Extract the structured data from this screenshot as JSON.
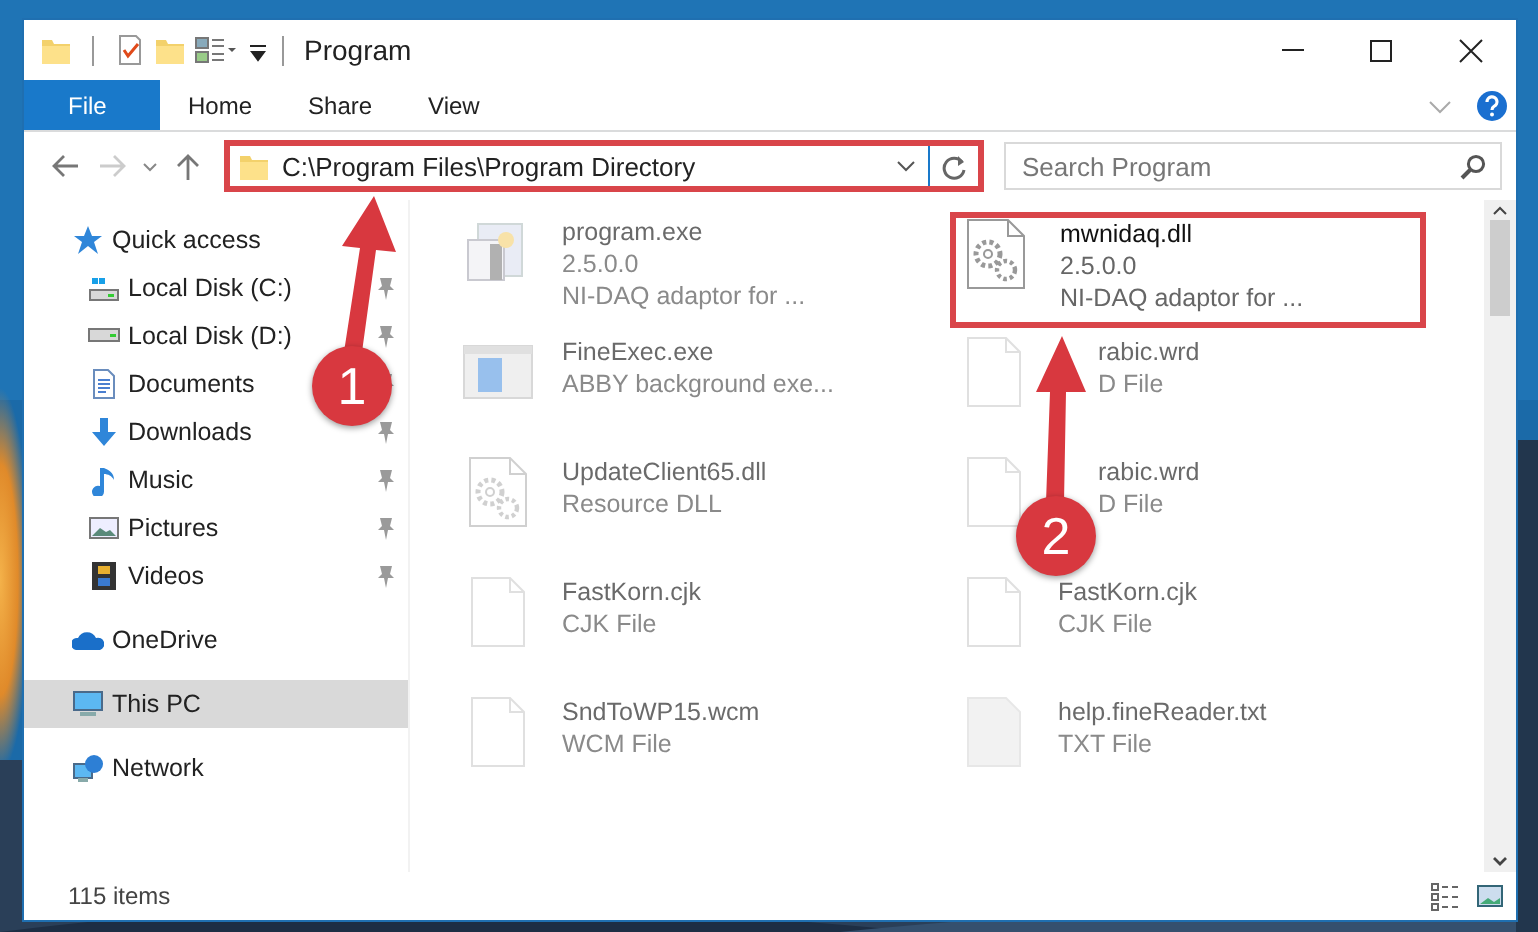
{
  "window": {
    "title": "Program"
  },
  "ribbon_tabs": [
    {
      "label": "File",
      "selected": true
    },
    {
      "label": "Home",
      "selected": false
    },
    {
      "label": "Share",
      "selected": false
    },
    {
      "label": "View",
      "selected": false
    }
  ],
  "address": {
    "path": "C:\\Program Files\\Program Directory",
    "highlighted": true
  },
  "search": {
    "placeholder": "Search Program"
  },
  "sidebar": {
    "items": [
      {
        "label": "Quick access",
        "selected": false,
        "children": [
          {
            "label": "Local Disk (C:)",
            "pinned": true,
            "selected": false
          },
          {
            "label": "Local Disk (D:)",
            "pinned": true,
            "selected": false
          },
          {
            "label": "Documents",
            "pinned": true,
            "selected": false
          },
          {
            "label": "Downloads",
            "pinned": true,
            "selected": false
          },
          {
            "label": "Music",
            "pinned": true,
            "selected": false
          },
          {
            "label": "Pictures",
            "pinned": true,
            "selected": false
          },
          {
            "label": "Videos",
            "pinned": true,
            "selected": false
          }
        ]
      },
      {
        "label": "OneDrive",
        "selected": false
      },
      {
        "label": "This PC",
        "selected": true
      },
      {
        "label": "Network",
        "selected": false
      }
    ]
  },
  "files": [
    {
      "kind": "app",
      "lines": [
        "program.exe",
        "2.5.0.0",
        "NI-DAQ adaptor for ..."
      ],
      "faded": true,
      "highlighted": false
    },
    {
      "kind": "settings-doc",
      "lines": [
        "mwnidaq.dll",
        "2.5.0.0",
        "NI-DAQ adaptor for ..."
      ],
      "faded": false,
      "highlighted": true
    },
    {
      "kind": "window",
      "lines": [
        "FineExec.exe",
        "ABBY background exe..."
      ],
      "faded": true,
      "highlighted": false
    },
    {
      "kind": "doc",
      "lines": [
        "rabic.wrd",
        "D File"
      ],
      "faded": true,
      "highlighted": false
    },
    {
      "kind": "settings-doc",
      "lines": [
        "UpdateClient65.dll",
        "Resource DLL"
      ],
      "faded": true,
      "highlighted": false
    },
    {
      "kind": "doc",
      "lines": [
        "rabic.wrd",
        "D File"
      ],
      "faded": true,
      "highlighted": false
    },
    {
      "kind": "doc",
      "lines": [
        "FastKorn.cjk",
        "CJK File"
      ],
      "faded": true,
      "highlighted": false
    },
    {
      "kind": "doc",
      "lines": [
        "FastKorn.cjk",
        "CJK File"
      ],
      "faded": true,
      "highlighted": false
    },
    {
      "kind": "doc",
      "lines": [
        "SndToWP15.wcm",
        "WCM File"
      ],
      "faded": true,
      "highlighted": false
    },
    {
      "kind": "grey-doc",
      "lines": [
        "help.fineReader.txt",
        "TXT File"
      ],
      "faded": true,
      "highlighted": false
    }
  ],
  "status_bar": {
    "text": "115 items"
  },
  "callouts": [
    {
      "label": "1"
    },
    {
      "label": "2"
    }
  ]
}
